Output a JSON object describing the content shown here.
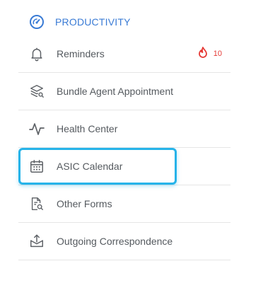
{
  "section": {
    "title": "PRODUCTIVITY",
    "icon": "gauge-icon"
  },
  "items": [
    {
      "label": "Reminders",
      "icon": "bell-icon",
      "badge": {
        "icon": "flame-icon",
        "count": "10",
        "color": "#e53935"
      }
    },
    {
      "label": "Bundle Agent Appointment",
      "icon": "layers-search-icon"
    },
    {
      "label": "Health Center",
      "icon": "pulse-icon"
    },
    {
      "label": "ASIC Calendar",
      "icon": "calendar-icon",
      "highlighted": true
    },
    {
      "label": "Other Forms",
      "icon": "document-search-icon"
    },
    {
      "label": "Outgoing Correspondence",
      "icon": "outbox-icon"
    }
  ],
  "colors": {
    "accent": "#3a7bd5",
    "text": "#555a5f",
    "highlight": "#26b3e9",
    "badge": "#e53935",
    "divider": "#e6e6e6"
  }
}
